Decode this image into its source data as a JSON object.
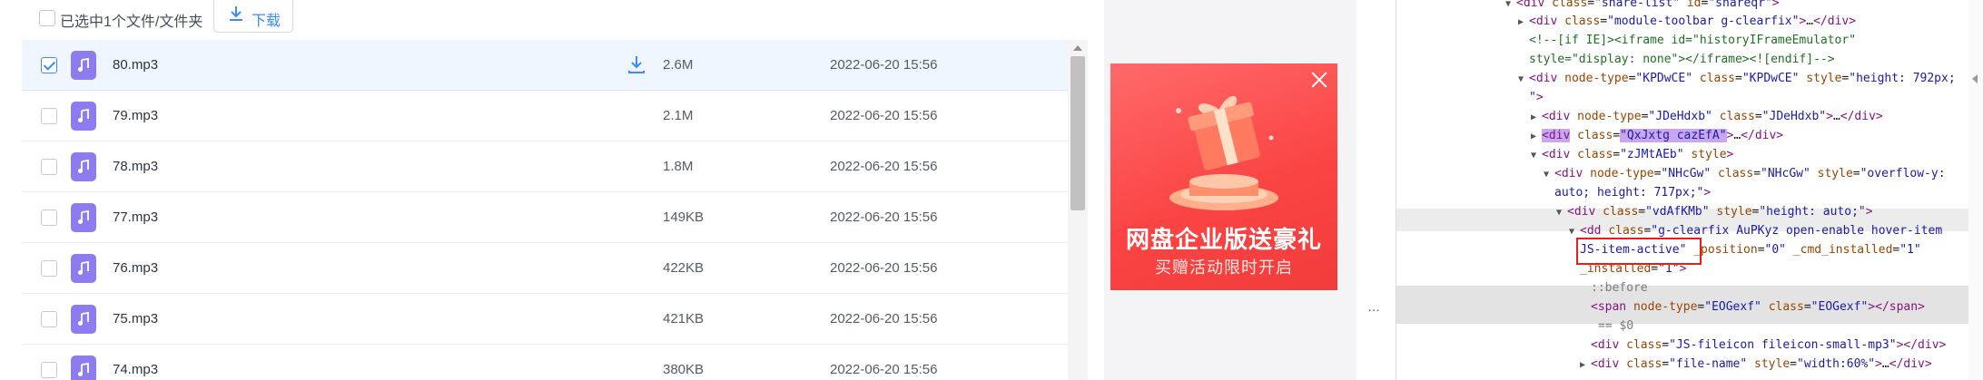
{
  "toolbar": {
    "selected_text": "已选中1个文件/文件夹",
    "download_label": "下载"
  },
  "files": [
    {
      "name": "80.mp3",
      "size": "2.6M",
      "date": "2022-06-20 15:56",
      "checked": true
    },
    {
      "name": "79.mp3",
      "size": "2.1M",
      "date": "2022-06-20 15:56",
      "checked": false
    },
    {
      "name": "78.mp3",
      "size": "1.8M",
      "date": "2022-06-20 15:56",
      "checked": false
    },
    {
      "name": "77.mp3",
      "size": "149KB",
      "date": "2022-06-20 15:56",
      "checked": false
    },
    {
      "name": "76.mp3",
      "size": "422KB",
      "date": "2022-06-20 15:56",
      "checked": false
    },
    {
      "name": "75.mp3",
      "size": "421KB",
      "date": "2022-06-20 15:56",
      "checked": false
    },
    {
      "name": "74.mp3",
      "size": "380KB",
      "date": "2022-06-20 15:56",
      "checked": false
    }
  ],
  "ad": {
    "title": "网盘企业版送豪礼",
    "subtitle": "买赠活动限时开启"
  },
  "devtools": {
    "lines": [
      {
        "t": "<div class=\"share-list\" id=\"shareqr\">"
      },
      {
        "t": "<div class=\"module-toolbar g-clearfix\">…</div>"
      },
      {
        "t": "<!--[if IE]><iframe id=\"historyIFrameEmulator\""
      },
      {
        "t": "style=\"display: none\"></iframe><![endif]-->"
      },
      {
        "t": "<div node-type=\"KPDwCE\" class=\"KPDwCE\" style=\"height: 792px;"
      },
      {
        "t": "\">"
      },
      {
        "t": "<div node-type=\"JDeHdxb\" class=\"JDeHdxb\">…</div>"
      },
      {
        "t": "<div class=\"QxJxtg cazEfA\">…</div>"
      },
      {
        "t": "<div class=\"zJMtAEb\" style>"
      },
      {
        "t": "<div node-type=\"NHcGw\" class=\"NHcGw\" style=\"overflow-y:"
      },
      {
        "t": "auto; height: 717px;\">"
      },
      {
        "t": "<div class=\"vdAfKMb\" style=\"height: auto;\">"
      },
      {
        "t": "<dd class=\"g-clearfix AuPKyz open-enable hover-item"
      },
      {
        "t": "JS-item-active\" _position=\"0\" _cmd_installed=\"1\""
      },
      {
        "t": "_installed=\"1\">"
      },
      {
        "t": "::before"
      },
      {
        "t": "<span node-type=\"EOGexf\" class=\"EOGexf\"></span>"
      },
      {
        "t": "== $0"
      },
      {
        "t": "<div class=\"JS-fileicon fileicon-small-mp3\"></div>"
      },
      {
        "t": "<div class=\"file-name\" style=\"width:60%\">…</div>"
      }
    ],
    "more_dots": "…"
  }
}
